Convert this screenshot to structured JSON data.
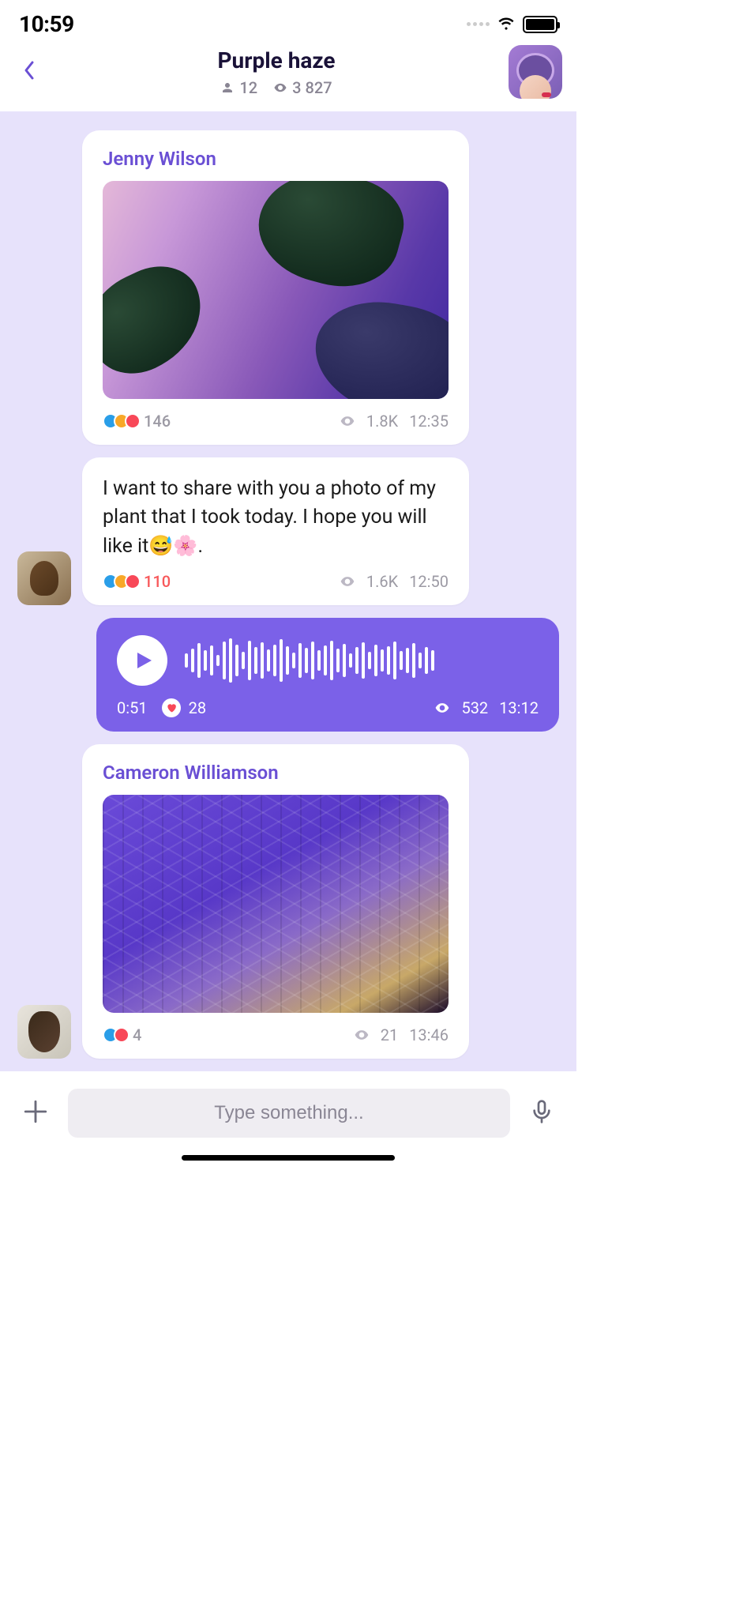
{
  "status": {
    "time": "10:59"
  },
  "header": {
    "title": "Purple haze",
    "members": "12",
    "views": "3 827"
  },
  "messages": {
    "m1": {
      "sender": "Jenny Wilson",
      "reactions": "146",
      "views": "1.8K",
      "time": "12:35"
    },
    "m2": {
      "text": "I want to share with you a photo of my plant that I took today. I hope you will like it😅🌸.",
      "reactions": "110",
      "views": "1.6K",
      "time": "12:50"
    },
    "audio": {
      "duration": "0:51",
      "reactions": "28",
      "views": "532",
      "time": "13:12"
    },
    "m3": {
      "sender": "Cameron Williamson",
      "reactions": "4",
      "views": "21",
      "time": "13:46"
    }
  },
  "composer": {
    "placeholder": "Type something..."
  }
}
